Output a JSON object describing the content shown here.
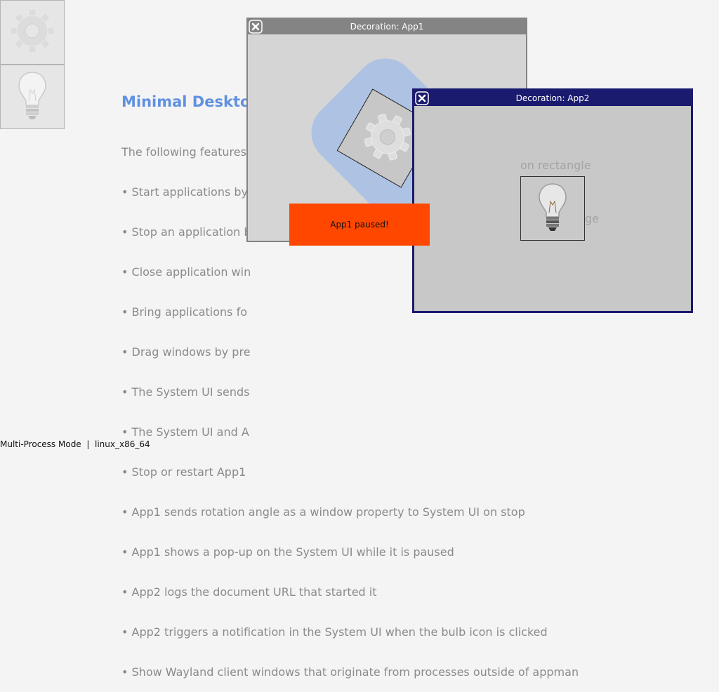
{
  "launcher": {
    "apps": [
      {
        "icon": "gear-icon"
      },
      {
        "icon": "lightbulb-icon"
      }
    ]
  },
  "description": {
    "title": "Minimal Desktop",
    "lines": [
      "The following features",
      "• Start applications by",
      "• Stop an application b",
      "• Close application win",
      "• Bring applications fo",
      "• Drag windows by pre",
      "• The System UI sends",
      "• The System UI and A",
      "• Stop or restart App1",
      "• App1 sends rotation angle as a window property to System UI on stop",
      "• App1 shows a pop-up on the System UI while it is paused",
      "• App2 logs the document URL that started it",
      "• App2 triggers a notification in the System UI when the bulb icon is clicked",
      "• Show Wayland client windows that originate from processes outside of appman"
    ],
    "fragments": [
      "on rectangle",
      "ge"
    ]
  },
  "windows": {
    "app1": {
      "title": "Decoration: App1",
      "close_icon": "close-icon"
    },
    "app2": {
      "title": "Decoration: App2",
      "close_icon": "close-icon"
    }
  },
  "popup": {
    "text": "App1 paused!"
  },
  "statusbar": {
    "text": "Multi-Process Mode  |  linux_x86_64"
  },
  "colors": {
    "title_accent": "#5f91e2",
    "app1_titlebar": "#848484",
    "app2_titlebar": "#1a1a6e",
    "popup_bg": "#ff4700"
  }
}
